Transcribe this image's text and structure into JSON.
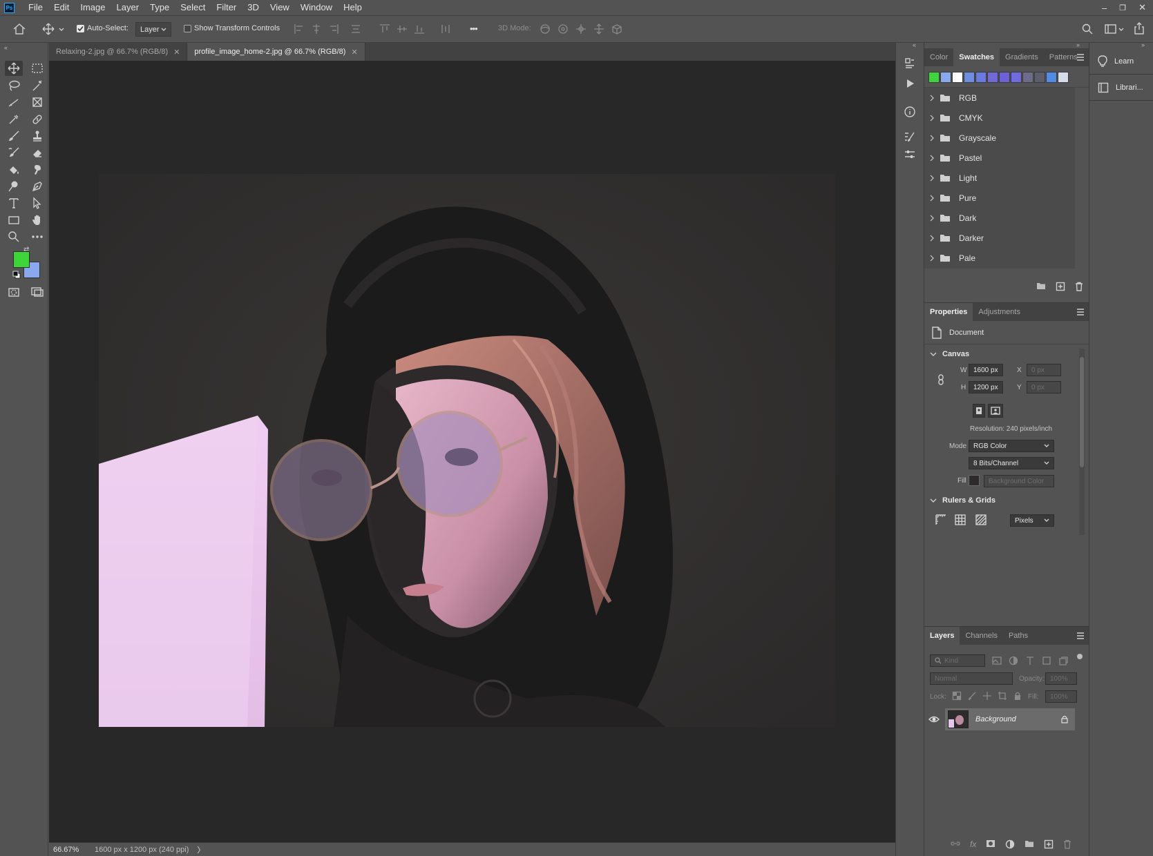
{
  "app": {
    "logo": "Ps"
  },
  "menu": [
    "File",
    "Edit",
    "Image",
    "Layer",
    "Type",
    "Select",
    "Filter",
    "3D",
    "View",
    "Window",
    "Help"
  ],
  "window_controls": {
    "minimize": "–",
    "restore": "❐",
    "close": "✕"
  },
  "options": {
    "auto_select_label": "Auto-Select:",
    "auto_select_checked": true,
    "auto_select_target": "Layer",
    "show_transform_label": "Show Transform Controls",
    "more_glyph": "•••",
    "mode_3d_label": "3D Mode:"
  },
  "tabs": [
    {
      "title": "Relaxing-2.jpg @ 66.7% (RGB/8)",
      "active": false
    },
    {
      "title": "profile_image_home-2.jpg @ 66.7% (RGB/8)",
      "active": true
    }
  ],
  "status": {
    "zoom": "66.67%",
    "doc_info": "1600 px x 1200 px (240 ppi)",
    "arrow": "〉"
  },
  "tool_colors": {
    "foreground": "#3fd43a",
    "background": "#8aa8ee"
  },
  "swatches_panel": {
    "tabs": [
      "Color",
      "Swatches",
      "Gradients",
      "Patterns"
    ],
    "active_tab": "Swatches",
    "recent_colors": [
      "#3fd43a",
      "#8aa8ee",
      "#ffffff",
      "#6e8fe0",
      "#6a7ae0",
      "#6f6ad8",
      "#6a62d6",
      "#6f6ce0",
      "#6c6c88",
      "#5e5e6a",
      "#4e8ce8",
      "#d6dde8"
    ],
    "folders": [
      "RGB",
      "CMYK",
      "Grayscale",
      "Pastel",
      "Light",
      "Pure",
      "Dark",
      "Darker",
      "Pale"
    ]
  },
  "properties_panel": {
    "tabs": [
      "Properties",
      "Adjustments"
    ],
    "active_tab": "Properties",
    "doc_label": "Document",
    "canvas_section": "Canvas",
    "w_label": "W",
    "w_value": "1600 px",
    "h_label": "H",
    "h_value": "1200 px",
    "x_label": "X",
    "x_value": "0 px",
    "y_label": "Y",
    "y_value": "0 px",
    "resolution": "Resolution: 240 pixels/inch",
    "mode_label": "Mode",
    "mode_value": "RGB Color",
    "bits_value": "8 Bits/Channel",
    "fill_label": "Fill",
    "fill_value": "Background Color",
    "rulers_section": "Rulers & Grids",
    "units_value": "Pixels"
  },
  "layers_panel": {
    "tabs": [
      "Layers",
      "Channels",
      "Paths"
    ],
    "active_tab": "Layers",
    "kind_placeholder": "Kind",
    "blend_mode": "Normal",
    "opacity_label": "Opacity:",
    "opacity_value": "100%",
    "lock_label": "Lock:",
    "fill_label": "Fill:",
    "fill_value": "100%",
    "layers": [
      {
        "name": "Background",
        "visible": true,
        "locked": true
      }
    ]
  },
  "learn_column": {
    "items": [
      "Learn",
      "Librari..."
    ]
  }
}
